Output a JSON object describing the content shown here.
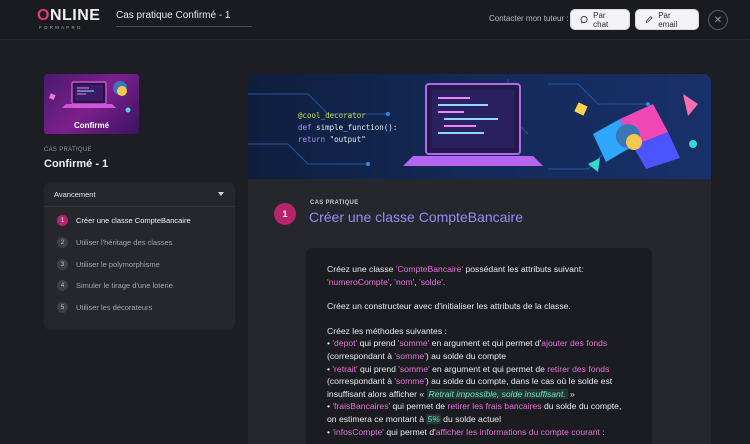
{
  "header": {
    "logo_main": "NLINE",
    "logo_o": "O",
    "logo_sub": "FORMAPRO",
    "course_title": "Cas pratique Confirmé - 1",
    "contact_label": "Contacter mon tuteur :",
    "chat_label": "Par chat",
    "email_label": "Par email",
    "close_symbol": "✕"
  },
  "sidebar": {
    "thumb_label": "Confirmé",
    "case_small": "CAS PRATIQUE",
    "case_title": "Confirmé - 1",
    "progress_title": "Avancement",
    "steps": [
      {
        "num": "1",
        "label": "Créer une classe CompteBancaire",
        "active": true
      },
      {
        "num": "2",
        "label": "Utiliser l'héritage des classes",
        "active": false
      },
      {
        "num": "3",
        "label": "Utiliser le polymorphisme",
        "active": false
      },
      {
        "num": "4",
        "label": "Simuler le tirage d'une loterie",
        "active": false
      },
      {
        "num": "5",
        "label": "Utiliser les décorateurs",
        "active": false
      }
    ]
  },
  "banner": {
    "code_line1": "@cool_decorator",
    "code_kw_def": "def",
    "code_fn": " simple_function():",
    "code_kw_return": "return",
    "code_str": " \"output\""
  },
  "exercise": {
    "number": "1",
    "kicker": "CAS PRATIQUE",
    "title": "Créer une classe CompteBancaire",
    "p1_a": "Créez une classe ",
    "p1_b": "'CompteBancaire'",
    "p1_c": " possédant les attributs suivant: ",
    "p1_d": "'numeroCompte'",
    "p1_e": ", ",
    "p1_f": "'nom'",
    "p1_g": ", ",
    "p1_h": "'solde'",
    "p1_i": ".",
    "p2": "Créez un constructeur avec d'initialiser les attributs de la classe.",
    "p3_intro": "Créez les méthodes suivantes :",
    "b1_a": "• ",
    "b1_b": "'depot'",
    "b1_c": " qui prend ",
    "b1_d": "'somme'",
    "b1_e": " en argument et qui permet d'",
    "b1_f": "ajouter des fonds",
    "b1_g": " (correspondant à ",
    "b1_h": "'somme'",
    "b1_i": ") au solde du compte",
    "b2_a": "• ",
    "b2_b": "'retrait'",
    "b2_c": " qui prend ",
    "b2_d": "'somme'",
    "b2_e": " en argument et qui permet de ",
    "b2_f": "retirer des fonds",
    "b2_g": " (correspondant à ",
    "b2_h": "'somme'",
    "b2_i": ") au solde du compte, dans le cas où le solde est insuffisant alors afficher « ",
    "b2_j": "Retrait impossible, solde insuffisant.",
    "b2_k": " »",
    "b3_a": "• ",
    "b3_b": "'fraisBancaires'",
    "b3_c": " qui permet de ",
    "b3_d": "retirer les frais bancaires",
    "b3_e": " du solde du compte, on estimera ce montant à ",
    "b3_f": "5%",
    "b3_g": " du solde actuel",
    "b4_a": "• ",
    "b4_b": "'infosCompte'",
    "b4_c": " qui permet d'",
    "b4_d": "afficher les informations du compte courant",
    "b4_e": " :"
  },
  "colors": {
    "accent_pink": "#b8246a",
    "title_purple": "#8f8ff7",
    "code_pink": "#e772d9",
    "warn_teal": "#6fe0c8"
  }
}
